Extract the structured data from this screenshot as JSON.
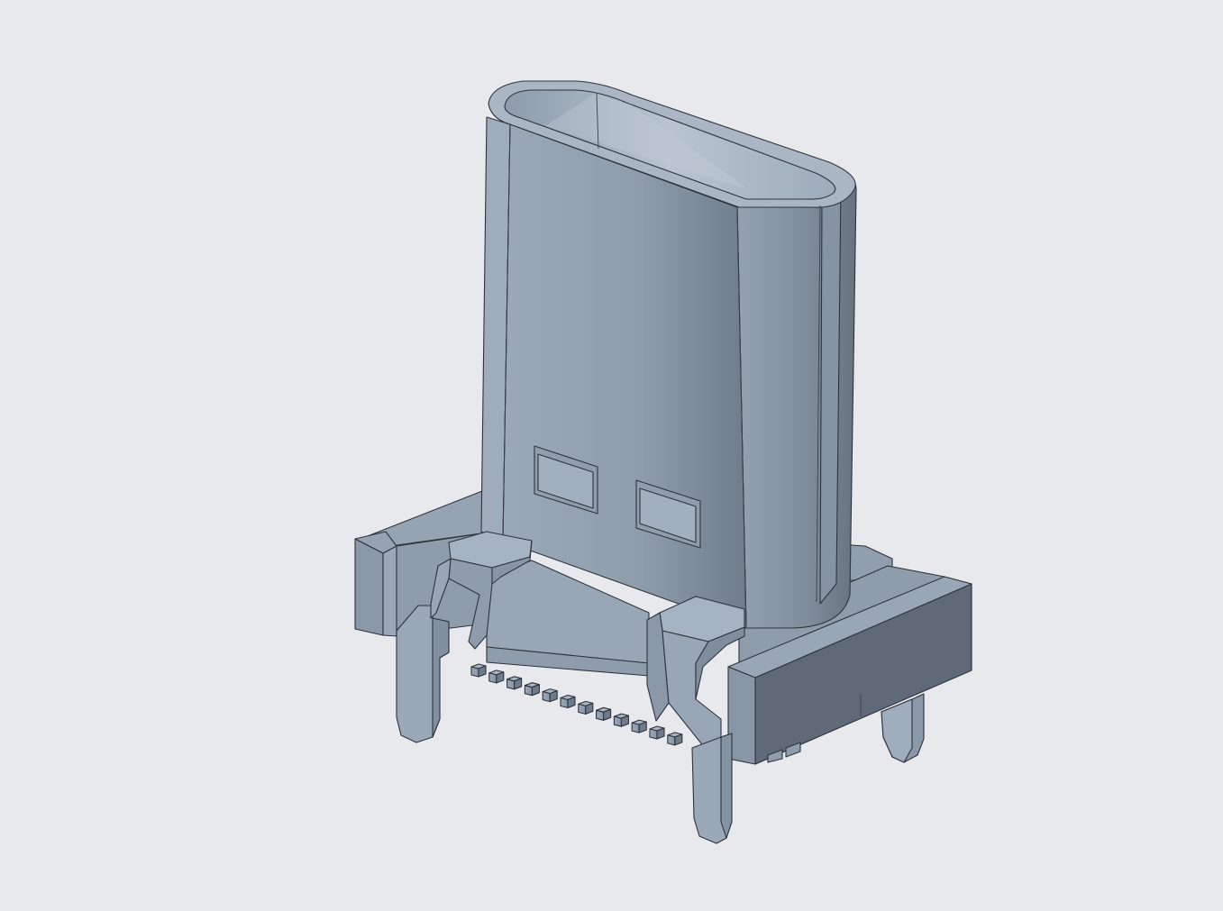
{
  "scene": {
    "background": "#e8e9ed",
    "model": "vertical-usb-type-c-receptacle-connector",
    "palette": {
      "face_light": "#a3b0bf",
      "face_mid": "#98a7b7",
      "face_dark": "#7d8b9b",
      "face_shadow": "#5f6977",
      "interior": "#b4c0cd",
      "edge": "#2e343c"
    }
  }
}
